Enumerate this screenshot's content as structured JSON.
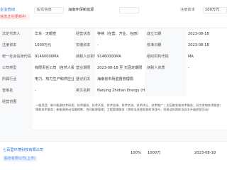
{
  "header": {
    "badge": "企业查询",
    "note": "信息正在更新中",
    "tag": "股东信息",
    "company": "海南环保新能源",
    "register_label": "注册资本",
    "register_value": "100万元"
  },
  "info": {
    "rows": [
      {
        "label1": "法定代表人",
        "value1": "华东 · 天眼查",
        "label2": "经营状态",
        "value2": "存续（在营、开业、在册）",
        "label3": "成立日期",
        "value3": "2023-08-18"
      },
      {
        "label1": "注册资本",
        "value1": "1000万元",
        "label2": "实缴资本",
        "value2": "-",
        "label3": "核准日期",
        "value3": "2023-08-18"
      },
      {
        "label1": "统一社会信用代码",
        "value1": "91460000MA",
        "label2": "纳税人识别号",
        "value2": "91460000MA",
        "label3": "组织机构代码",
        "value3": "MA"
      },
      {
        "label1": "公司类型",
        "value1": "有限责任公司（自然人投资或控股）",
        "label2": "营业期限",
        "value2": "2023-08-18 至 无固定期限",
        "label3": "纳税人资质",
        "value3": "-"
      },
      {
        "label1": "所属行业",
        "value1": "电力、热力生产和供应业",
        "label2": "登记机关",
        "value2": "海南省市场监督管理局",
        "label3": "",
        "value3": ""
      },
      {
        "label1": "曾用名",
        "value1": "-",
        "label2": "英文名称",
        "value2": "Nanjing Zhidian Energy (Hainan) Co., Ltd.",
        "label3": "",
        "value3": ""
      }
    ]
  },
  "scope": {
    "label": "经营范围",
    "text": "一般项目：新兴能源技术研发；技术服务、技术开发、技术咨询、技术交流、技术转让、技术推广；太阳能发电技术服务；风力发电技术服务；储能技术服务；新能源原动设备销售；合同能源管理；工程管理服务（除依法须经批准的项目外，凭营业执照依法自主开展经营活动）"
  },
  "investment": {
    "row": {
      "company_name": "七百里环境科技有限公司",
      "company_chip": "股份有限公司(上市)",
      "ratio": "100%",
      "amount": "1000万",
      "date": "2023-08-18"
    }
  }
}
